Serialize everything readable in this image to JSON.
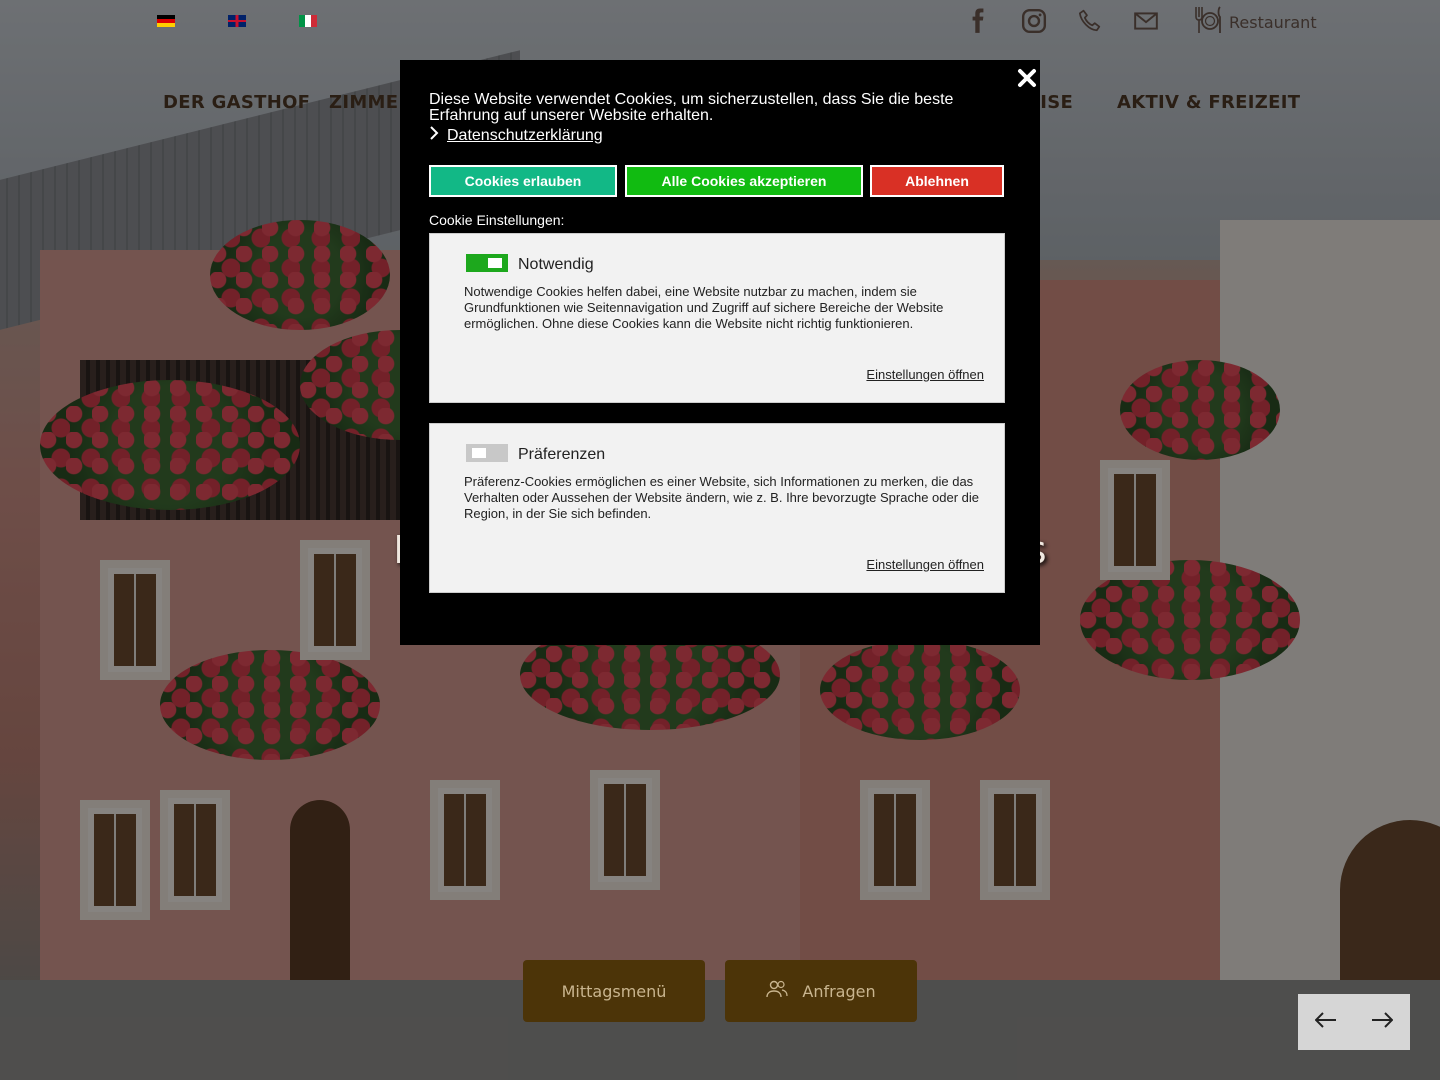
{
  "languages": [
    {
      "code": "de",
      "label": "Deutsch"
    },
    {
      "code": "en",
      "label": "English"
    },
    {
      "code": "it",
      "label": "Italiano"
    }
  ],
  "topbar": {
    "social_icons": [
      "facebook-icon",
      "instagram-icon",
      "phone-icon",
      "mail-icon"
    ],
    "restaurant_label": "Restaurant"
  },
  "nav": {
    "items": [
      "DER GASTHOF",
      "ZIMMER",
      "PREISE",
      "AKTIV & FREIZEIT"
    ]
  },
  "hero": {
    "subtitle": "Hotel / Restaurant / Appartements"
  },
  "cta": {
    "lunch_label": "Mittagsmenü",
    "inquire_label": "Anfragen"
  },
  "cookie": {
    "intro": "Diese Website verwendet Cookies, um sicherzustellen, dass Sie die beste Erfahrung auf unserer Website erhalten.",
    "privacy_link": "Datenschutzerklärung",
    "allow_label": "Cookies erlauben",
    "accept_all_label": "Alle Cookies akzeptieren",
    "deny_label": "Ablehnen",
    "settings_label": "Cookie Einstellungen:",
    "categories": [
      {
        "title": "Notwendig",
        "enabled": true,
        "description": "Notwendige Cookies helfen dabei, eine Website nutzbar zu machen, indem sie Grundfunktionen wie Seitennavigation und Zugriff auf sichere Bereiche der Website ermöglichen. Ohne diese Cookies kann die Website nicht richtig funktionieren.",
        "link": "Einstellungen öffnen"
      },
      {
        "title": "Präferenzen",
        "enabled": false,
        "description": "Präferenz-Cookies ermöglichen es einer Website, sich Informationen zu merken, die das Verhalten oder Aussehen der Website ändern, wie z. B. Ihre bevorzugte Sprache oder die Region, in der Sie sich befinden.",
        "link": "Einstellungen öffnen"
      }
    ],
    "colors": {
      "allow": "#12b886",
      "accept_all": "#11bb11",
      "deny": "#d93025",
      "toggle_on": "#1da81d"
    }
  },
  "colors": {
    "cta_background": "#4c3408",
    "cta_text": "#c9b58f",
    "nav_text": "#2a1e14"
  }
}
